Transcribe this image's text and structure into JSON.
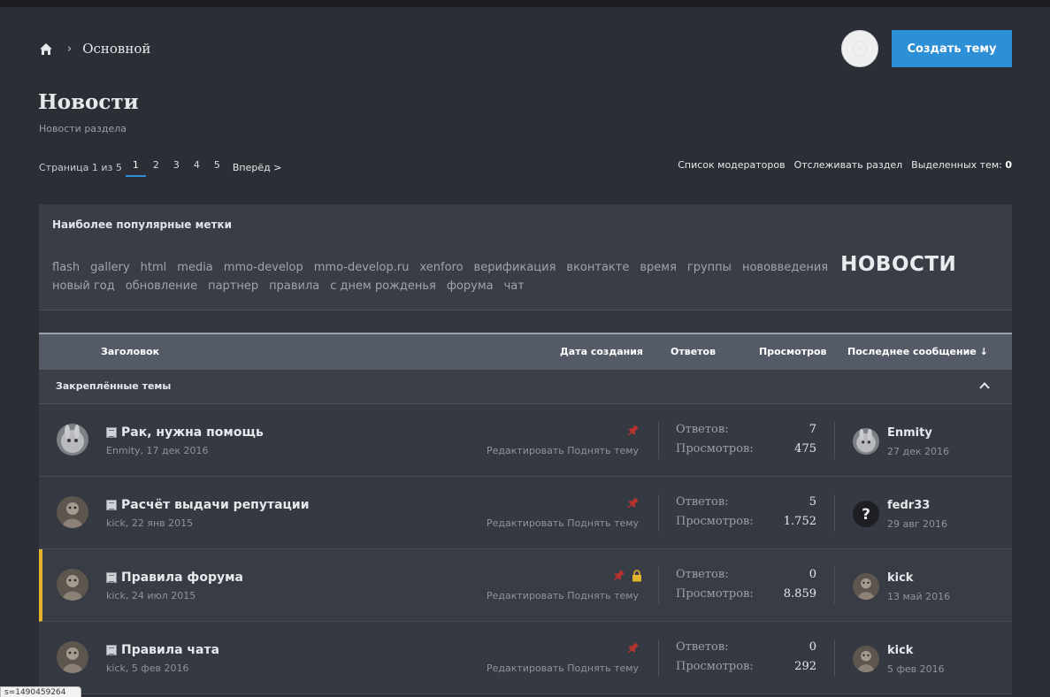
{
  "breadcrumb": {
    "home_icon": "home-icon",
    "separator": "›",
    "section": "Основной"
  },
  "header": {
    "compass_icon": "compass-icon",
    "create_label": "Создать тему",
    "accent": "#2d8fd6"
  },
  "page": {
    "title": "Новости",
    "description": "Новости раздела"
  },
  "pagination": {
    "label": "Страница 1 из 5",
    "pages": [
      "1",
      "2",
      "3",
      "4",
      "5"
    ],
    "current": "1",
    "next": "Вперёд >"
  },
  "moderation": {
    "moderators": "Список модераторов",
    "watch": "Отслеживать раздел",
    "selected_label": "Выделенных тем:",
    "selected_count": "0"
  },
  "tags": {
    "title": "Наиболее популярные метки",
    "line1": [
      "flash",
      "gallery",
      "html",
      "media",
      "mmo-develop",
      "mmo-develop.ru",
      "xenforo",
      "верификация",
      "вконтакте",
      "время",
      "группы",
      "нововведения"
    ],
    "featured": "НОВОСТИ",
    "line2": [
      "новый год",
      "обновление",
      "партнер",
      "правила",
      "с днем рожденья",
      "форума",
      "чат"
    ]
  },
  "table": {
    "columns": {
      "title": "Заголовок",
      "created": "Дата создания",
      "replies": "Ответов",
      "views": "Просмотров",
      "last": "Последнее сообщение ↓"
    },
    "sticky_label": "Закреплённые темы",
    "replies_label": "Ответов:",
    "views_label": "Просмотров:",
    "actions": "Редактировать Поднять тему"
  },
  "threads": [
    {
      "title": "Рак, нужна помощь",
      "meta": "Enmity, 17 дек 2016",
      "replies": "7",
      "views": "475",
      "last_user": "Enmity",
      "last_date": "27 дек 2016",
      "locked": false
    },
    {
      "title": "Расчёт выдачи репутации",
      "meta": "kick, 22 янв 2015",
      "replies": "5",
      "views": "1.752",
      "last_user": "fedr33",
      "last_date": "29 авг 2016",
      "locked": false
    },
    {
      "title": "Правила форума",
      "meta": "kick, 24 июл 2015",
      "replies": "0",
      "views": "8.859",
      "last_user": "kick",
      "last_date": "13 май 2016",
      "locked": true
    },
    {
      "title": "Правила чата",
      "meta": "kick, 5 фев 2016",
      "replies": "0",
      "views": "292",
      "last_user": "kick",
      "last_date": "5 фев 2016",
      "locked": false
    }
  ],
  "footer_tip": "s=1490459264"
}
